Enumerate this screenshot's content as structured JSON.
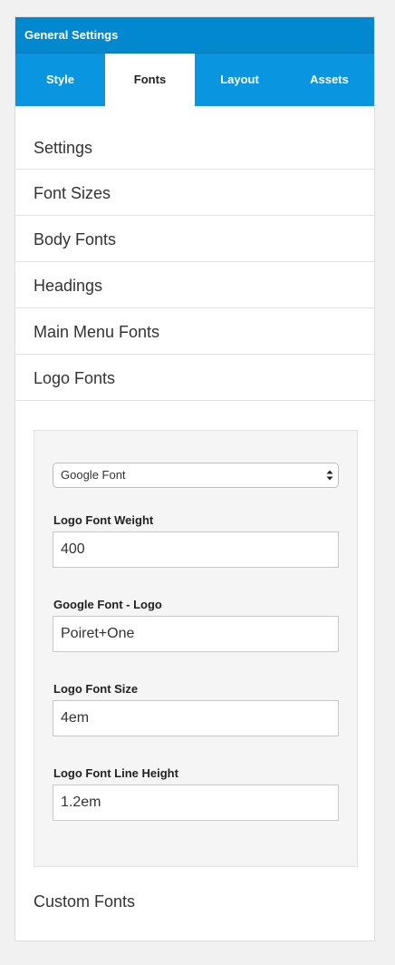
{
  "header": {
    "title": "General Settings"
  },
  "tabs": [
    {
      "label": "Style"
    },
    {
      "label": "Fonts"
    },
    {
      "label": "Layout"
    },
    {
      "label": "Assets"
    }
  ],
  "active_tab": "Fonts",
  "menu": [
    {
      "label": "Settings"
    },
    {
      "label": "Font Sizes"
    },
    {
      "label": "Body Fonts"
    },
    {
      "label": "Headings"
    },
    {
      "label": "Main Menu Fonts"
    },
    {
      "label": "Logo Fonts"
    }
  ],
  "logo_section": {
    "font_type_select": "Google Font",
    "fields": [
      {
        "label": "Logo Font Weight",
        "value": "400"
      },
      {
        "label": "Google Font - Logo",
        "value": "Poiret+One"
      },
      {
        "label": "Logo Font Size",
        "value": "4em"
      },
      {
        "label": "Logo Font Line Height",
        "value": "1.2em"
      }
    ]
  },
  "custom_fonts": {
    "label": "Custom Fonts"
  },
  "colors": {
    "header_bg": "#0288cf",
    "tabs_bg": "#0a95e0",
    "page_bg": "#f1f1f1"
  }
}
